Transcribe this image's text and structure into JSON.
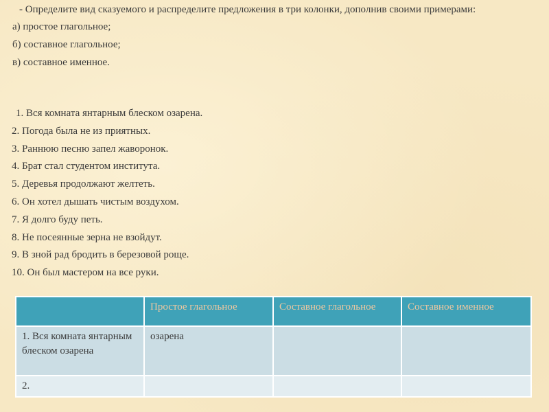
{
  "task": {
    "dash": "-",
    "text": "Определите вид сказуемого и распределите предложения в три колонки, дополнив своими примерами:"
  },
  "options": [
    "а) простое глагольное;",
    "б) составное глагольное;",
    "в) составное именное."
  ],
  "sentences": [
    "1. Вся комната янтарным блеском озарена.",
    "2. Погода была не из приятных.",
    "3. Раннюю песню запел жаворонок.",
    "4. Брат стал студентом института.",
    "5. Деревья продолжают желтеть.",
    "6. Он хотел дышать чистым воздухом.",
    "7. Я долго буду петь.",
    "8. Не посеянные зерна не взойдут.",
    "9. В зной рад бродить в березовой роще.",
    "10. Он был мастером на все руки."
  ],
  "table": {
    "headers": [
      "",
      "Простое глагольное",
      "Составное глагольное",
      "Составное именное"
    ],
    "rows": [
      [
        "1. Вся комната янтарным блеском озарена",
        "озарена",
        "",
        ""
      ],
      [
        "2.",
        "",
        "",
        ""
      ]
    ]
  },
  "colors": {
    "background": "#f7e8c4",
    "header_bg": "#3fa2b8",
    "header_text": "#f0c8a0",
    "row1_bg": "#cbdde4",
    "row2_bg": "#e3edf1"
  }
}
